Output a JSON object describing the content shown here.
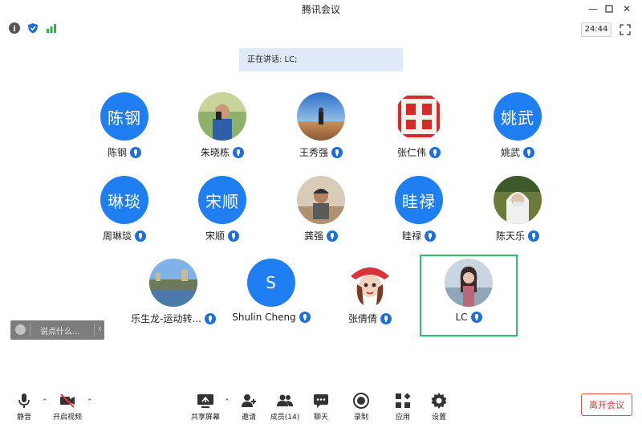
{
  "window": {
    "title": "腾讯会议"
  },
  "statusbar": {
    "timer": "24:44"
  },
  "speaking": {
    "text": "正在讲话: LC;"
  },
  "participants": [
    {
      "name": "陈钢",
      "avatar_type": "text",
      "avatar_text": "陈钢"
    },
    {
      "name": "朱晓栋",
      "avatar_type": "photo"
    },
    {
      "name": "王秀强",
      "avatar_type": "photo"
    },
    {
      "name": "张仁伟",
      "avatar_type": "photo"
    },
    {
      "name": "姚武",
      "avatar_type": "text",
      "avatar_text": "姚武"
    },
    {
      "name": "周琳琰",
      "avatar_type": "text",
      "avatar_text": "琳琰"
    },
    {
      "name": "宋顺",
      "avatar_type": "text",
      "avatar_text": "宋顺"
    },
    {
      "name": "龚强",
      "avatar_type": "photo"
    },
    {
      "name": "眭禄",
      "avatar_type": "text",
      "avatar_text": "眭禄"
    },
    {
      "name": "陈天乐",
      "avatar_type": "photo"
    },
    {
      "name": "乐生龙-运动转...",
      "avatar_type": "photo"
    },
    {
      "name": "Shulin Cheng",
      "avatar_type": "text",
      "avatar_text": "S"
    },
    {
      "name": "张倩倩",
      "avatar_type": "photo"
    },
    {
      "name": "LC",
      "avatar_type": "photo",
      "active_speaker": true
    }
  ],
  "chat": {
    "placeholder": "说点什么..."
  },
  "toolbar": {
    "mute": "静音",
    "video": "开启视频",
    "share": "共享屏幕",
    "invite": "邀请",
    "members": "成员(14)",
    "chat": "聊天",
    "record": "录制",
    "apps": "应用",
    "settings": "设置",
    "leave": "离开会议"
  },
  "colors": {
    "avatar_blue": "#1f7ef1",
    "speaker_border": "#25c56a",
    "leave_red": "#e23c3c"
  }
}
